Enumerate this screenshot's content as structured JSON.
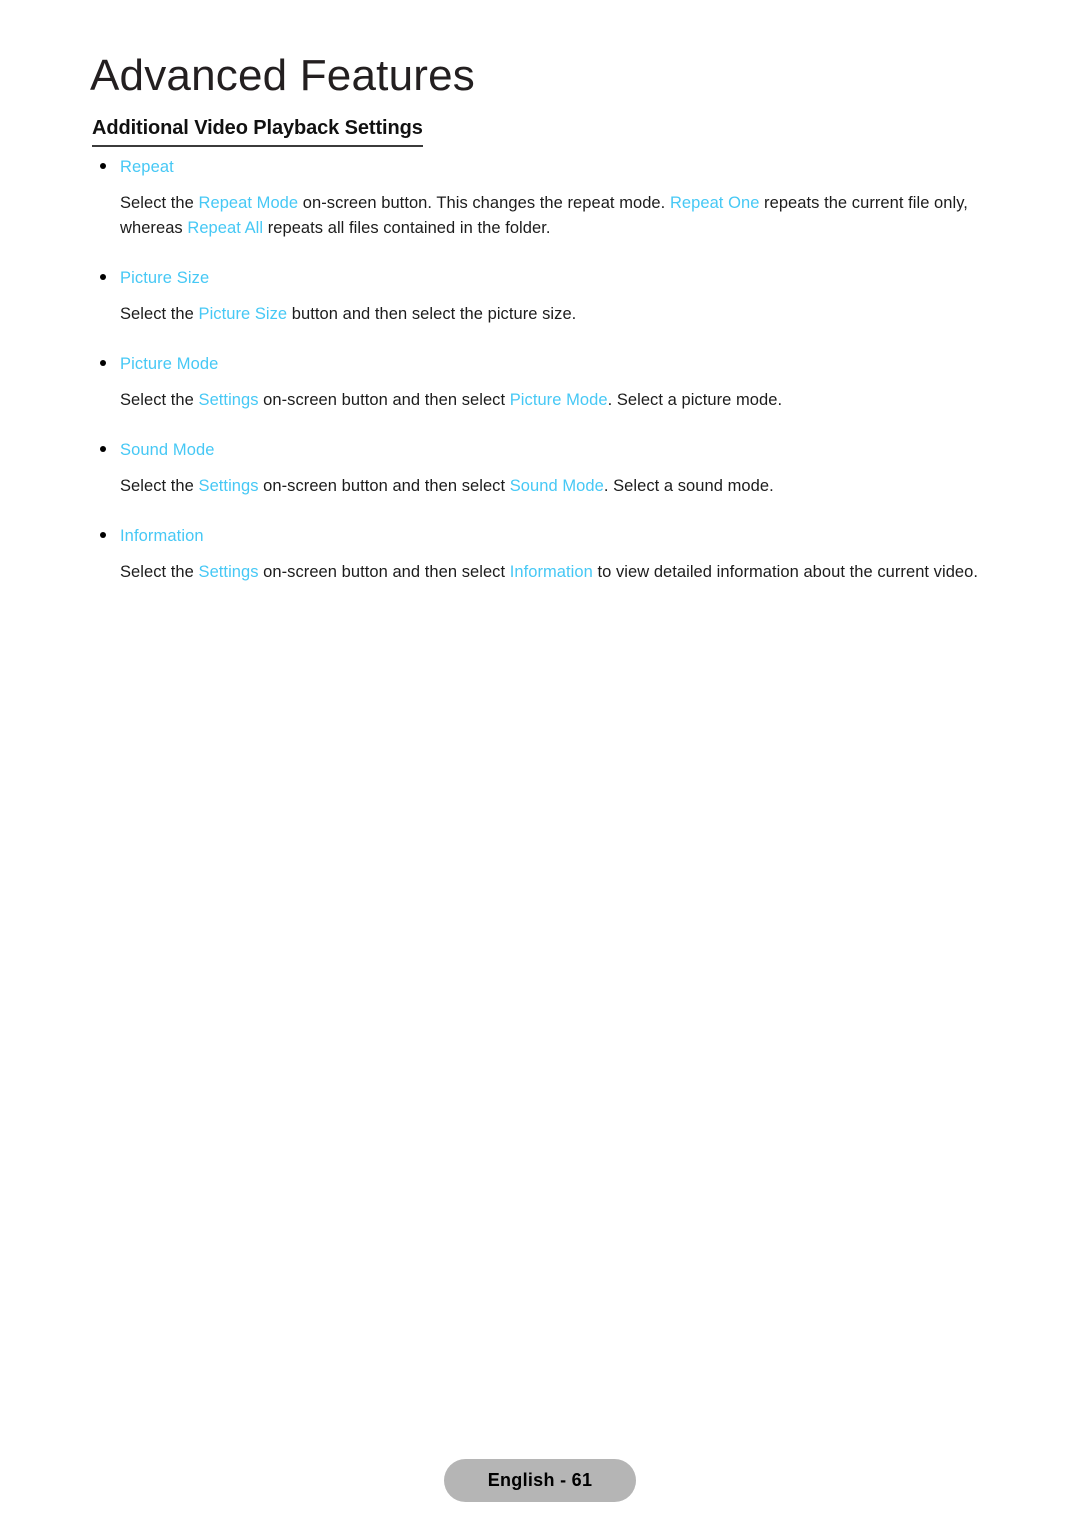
{
  "page": {
    "chapter_title": "Advanced Features",
    "section_heading": "Additional Video Playback Settings",
    "accent_color": "#46c8f5",
    "text_color": "#1c1c1c",
    "background_color": "#ffffff"
  },
  "entries": [
    {
      "label": "Repeat",
      "paragraph": {
        "p1": "Select the ",
        "t1": "Repeat Mode",
        "p2": " on-screen button. This changes the repeat mode. ",
        "t2": "Repeat One",
        "p3": " repeats the current file only, whereas ",
        "t3": "Repeat All",
        "p4": " repeats all files contained in the folder."
      }
    },
    {
      "label": "Picture Size",
      "paragraph": {
        "p1": "Select the ",
        "t1": "Picture Size",
        "p2": " button and then select the picture size."
      }
    },
    {
      "label": "Picture Mode",
      "paragraph": {
        "p1": "Select the ",
        "t1": "Settings",
        "p2": " on-screen button and then select ",
        "t2": "Picture Mode",
        "p3": ". Select a picture mode."
      }
    },
    {
      "label": "Sound Mode",
      "paragraph": {
        "p1": "Select the ",
        "t1": "Settings",
        "p2": " on-screen button and then select ",
        "t2": "Sound Mode",
        "p3": ". Select a sound mode."
      }
    },
    {
      "label": "Information",
      "paragraph": {
        "p1": "Select the ",
        "t1": "Settings",
        "p2": " on-screen button and then select ",
        "t2": "Information",
        "p3": " to view detailed information about the current video."
      }
    }
  ],
  "footer": {
    "page_label": "English - 61"
  }
}
